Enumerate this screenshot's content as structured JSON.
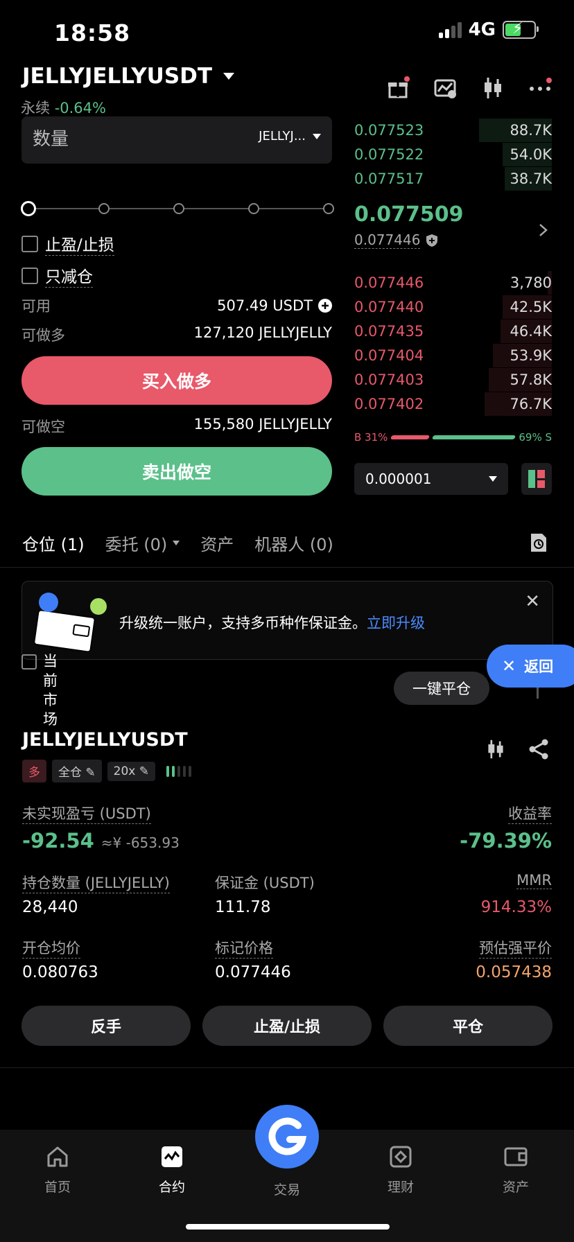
{
  "status": {
    "time": "18:58",
    "network": "4G"
  },
  "header": {
    "symbol": "JELLYJELLYUSDT",
    "contract_type": "永续",
    "change": "-0.64%"
  },
  "order_form": {
    "qty_label": "数量",
    "qty_unit": "JELLYJ...",
    "tp_sl_label": "止盈/止损",
    "reduce_only_label": "只减仓",
    "available_label": "可用",
    "available_value": "507.49 USDT",
    "max_long_label": "可做多",
    "max_long_value": "127,120 JELLYJELLY",
    "buy_label": "买入做多",
    "max_short_label": "可做空",
    "max_short_value": "155,580 JELLYJELLY",
    "sell_label": "卖出做空"
  },
  "order_book": {
    "asks": [
      {
        "price": "0.077523",
        "size": "88.7K",
        "depth": 0.37
      },
      {
        "price": "0.077522",
        "size": "54.0K",
        "depth": 0.25
      },
      {
        "price": "0.077517",
        "size": "38.7K",
        "depth": 0.24
      }
    ],
    "last_price": "0.077509",
    "mark_price": "0.077446",
    "bids": [
      {
        "price": "0.077446",
        "size": "3,780",
        "depth": 0.02
      },
      {
        "price": "0.077440",
        "size": "42.5K",
        "depth": 0.25
      },
      {
        "price": "0.077435",
        "size": "46.4K",
        "depth": 0.26
      },
      {
        "price": "0.077404",
        "size": "53.9K",
        "depth": 0.3
      },
      {
        "price": "0.077403",
        "size": "57.8K",
        "depth": 0.32
      },
      {
        "price": "0.077402",
        "size": "76.7K",
        "depth": 0.34
      }
    ],
    "buy_ratio_label": "B 31%",
    "sell_ratio_label": "69% S",
    "buy_ratio": 0.31,
    "tick_size": "0.000001"
  },
  "tabs": [
    {
      "label": "仓位 (1)"
    },
    {
      "label": "委托 (0)"
    },
    {
      "label": "资产"
    },
    {
      "label": "机器人 (0)"
    }
  ],
  "banner": {
    "text": "升级统一账户，支持多币种作保证金。",
    "link": "立即升级"
  },
  "overlay": {
    "back_label": "返回",
    "close_all_label": "一键平仓",
    "market_label": "当前市场"
  },
  "position": {
    "symbol": "JELLYJELLYUSDT",
    "side": "多",
    "margin_mode": "全仓",
    "leverage": "20x",
    "strength_level": 2,
    "unrealized_pnl_label": "未实现盈亏 (USDT)",
    "unrealized_pnl": "-92.54",
    "unrealized_pnl_cny": "≈¥ -653.93",
    "roi_label": "收益率",
    "roi": "-79.39%",
    "size_label": "持仓数量 (JELLYJELLY)",
    "size": "28,440",
    "margin_label": "保证金 (USDT)",
    "margin": "111.78",
    "mmr_label": "MMR",
    "mmr": "914.33%",
    "entry_label": "开仓均价",
    "entry": "0.080763",
    "mark_label": "标记价格",
    "mark": "0.077446",
    "liq_label": "预估强平价",
    "liq": "0.057438",
    "reverse_label": "反手",
    "tpsl_label": "止盈/止损",
    "close_label": "平仓"
  },
  "nav": [
    {
      "label": "首页",
      "icon": "home-icon"
    },
    {
      "label": "合约",
      "icon": "futures-icon"
    },
    {
      "label": "交易",
      "icon": "trade-icon"
    },
    {
      "label": "理财",
      "icon": "earn-icon"
    },
    {
      "label": "资产",
      "icon": "assets-icon"
    }
  ],
  "colors": {
    "green": "#5bc08a",
    "red": "#e8596a",
    "blue": "#3f7ef6",
    "orange": "#f3a46b"
  }
}
